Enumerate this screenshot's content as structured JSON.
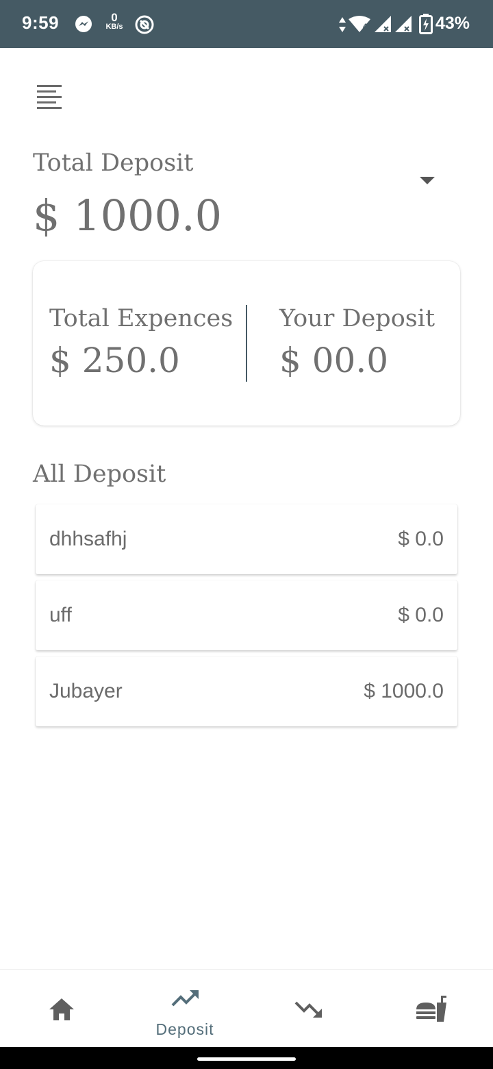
{
  "status_bar": {
    "time": "9:59",
    "data_speed_value": "0",
    "data_speed_unit": "KB/s",
    "battery": "43%",
    "network_type": "4"
  },
  "header": {
    "total_deposit_label": "Total Deposit",
    "total_deposit_value": "$ 1000.0"
  },
  "summary": {
    "expenses_label": "Total Expences",
    "expenses_value": "$ 250.0",
    "your_deposit_label": "Your Deposit",
    "your_deposit_value": "$ 00.0"
  },
  "all_deposit": {
    "title": "All Deposit",
    "items": [
      {
        "name": "dhhsafhj",
        "amount": "$ 0.0"
      },
      {
        "name": "uff",
        "amount": "$ 0.0"
      },
      {
        "name": "Jubayer",
        "amount": "$ 1000.0"
      }
    ]
  },
  "bottom_nav": {
    "items": [
      {
        "icon": "home-icon",
        "label": ""
      },
      {
        "icon": "trending-up-icon",
        "label": "Deposit",
        "active": true
      },
      {
        "icon": "trending-down-icon",
        "label": ""
      },
      {
        "icon": "fastfood-icon",
        "label": ""
      }
    ]
  },
  "colors": {
    "status_bar_bg": "#455a64",
    "text": "#707070",
    "accent": "#546e7a"
  }
}
